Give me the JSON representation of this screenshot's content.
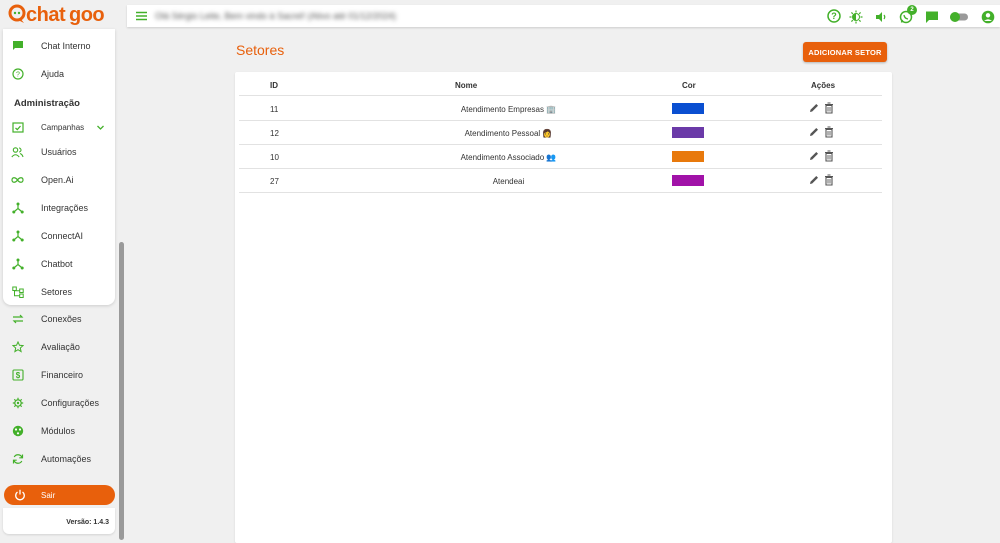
{
  "logo": {
    "text": "chatgoo",
    "accent_color": "#e8600c"
  },
  "sidebar": {
    "items_top": [
      {
        "label": "Chat Interno",
        "icon": "chat-icon"
      },
      {
        "label": "Ajuda",
        "icon": "help-icon"
      }
    ],
    "admin_heading": "Administração",
    "admin_items": [
      {
        "label": "Campanhas",
        "icon": "calendar-check-icon"
      },
      {
        "label": "Usuários",
        "icon": "people-icon"
      },
      {
        "label": "Open.Ai",
        "icon": "infinity-icon"
      },
      {
        "label": "Integrações",
        "icon": "hub-icon"
      },
      {
        "label": "ConnectAI",
        "icon": "hub-icon"
      },
      {
        "label": "Chatbot",
        "icon": "hub-icon"
      },
      {
        "label": "Setores",
        "icon": "account-tree-icon"
      }
    ],
    "other_items": [
      {
        "label": "Conexões",
        "icon": "sync-alt-icon"
      },
      {
        "label": "Avaliação",
        "icon": "star-icon"
      },
      {
        "label": "Financeiro",
        "icon": "dollar-icon"
      },
      {
        "label": "Configurações",
        "icon": "settings-icon"
      },
      {
        "label": "Módulos",
        "icon": "modules-icon"
      },
      {
        "label": "Automações",
        "icon": "refresh-icon"
      }
    ],
    "exit_label": "Sair",
    "version": "Versão: 1.4.3"
  },
  "topbar": {
    "welcome": "Olá Sérgio Leite, Bem vindo à Sacrel! (Ativo até 01/12/2024)",
    "whatsapp_badge": "2"
  },
  "page": {
    "title": "Setores",
    "add_button": "ADICIONAR SETOR"
  },
  "table": {
    "headers": {
      "id": "ID",
      "name": "Nome",
      "color": "Cor",
      "actions": "Ações"
    },
    "rows": [
      {
        "id": "11",
        "name": "Atendimento Empresas 🏢",
        "color": "#0a4fd1"
      },
      {
        "id": "12",
        "name": "Atendimento Pessoal 👩",
        "color": "#6b3aa8"
      },
      {
        "id": "10",
        "name": "Atendimento Associado 👥",
        "color": "#e8790c"
      },
      {
        "id": "27",
        "name": "Atendeai",
        "color": "#a112a8"
      }
    ]
  },
  "colors": {
    "brand_orange": "#e8600c",
    "icon_green": "#43b02a"
  }
}
